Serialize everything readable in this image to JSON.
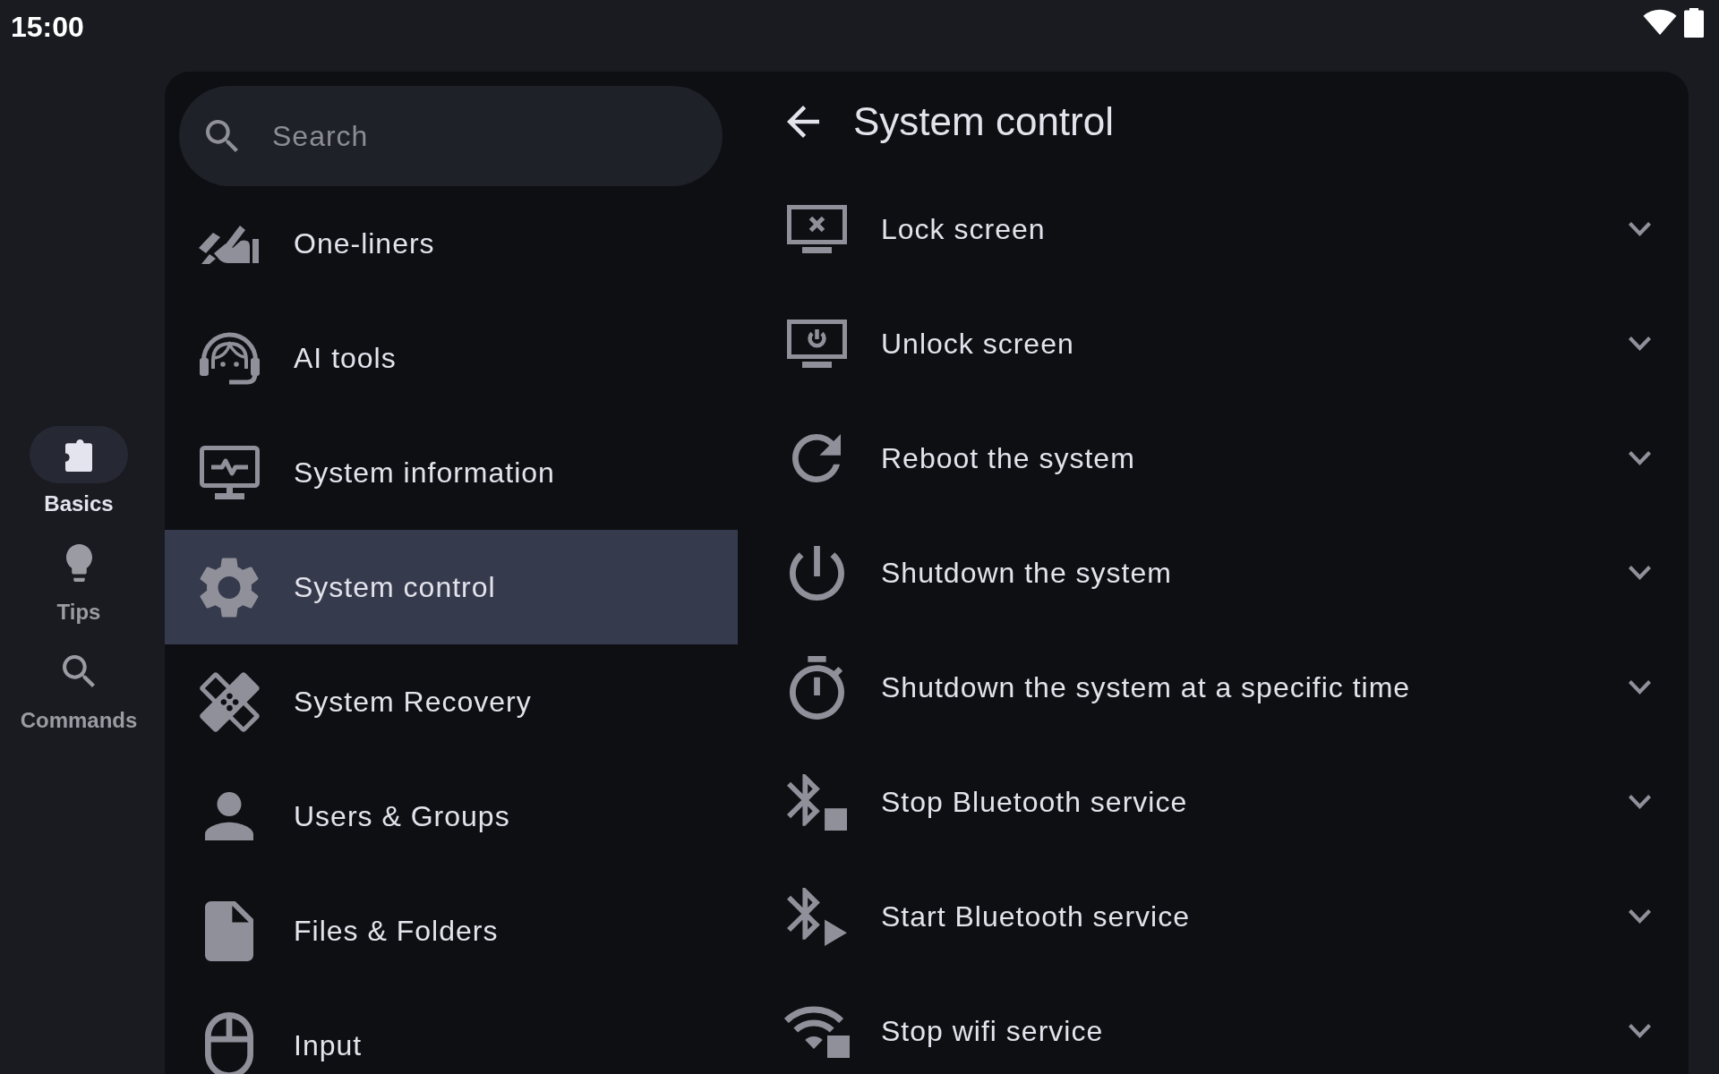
{
  "status_bar": {
    "time": "15:00"
  },
  "nav_rail": {
    "items": [
      {
        "label": "Basics",
        "selected": true
      },
      {
        "label": "Tips",
        "selected": false
      },
      {
        "label": "Commands",
        "selected": false
      }
    ]
  },
  "categories": {
    "search": {
      "placeholder": "Search"
    },
    "items": [
      {
        "label": "One-liners",
        "selected": false
      },
      {
        "label": "AI tools",
        "selected": false
      },
      {
        "label": "System information",
        "selected": false
      },
      {
        "label": "System control",
        "selected": true
      },
      {
        "label": "System Recovery",
        "selected": false
      },
      {
        "label": "Users & Groups",
        "selected": false
      },
      {
        "label": "Files & Folders",
        "selected": false
      },
      {
        "label": "Input",
        "selected": false
      }
    ]
  },
  "detail": {
    "title": "System control",
    "items": [
      {
        "label": "Lock screen",
        "expanded": false
      },
      {
        "label": "Unlock screen",
        "expanded": false
      },
      {
        "label": "Reboot the system",
        "expanded": false
      },
      {
        "label": "Shutdown the system",
        "expanded": false
      },
      {
        "label": "Shutdown the system at a specific time",
        "expanded": false
      },
      {
        "label": "Stop Bluetooth service",
        "expanded": false
      },
      {
        "label": "Start Bluetooth service",
        "expanded": false
      },
      {
        "label": "Stop wifi service",
        "expanded": false
      }
    ]
  }
}
